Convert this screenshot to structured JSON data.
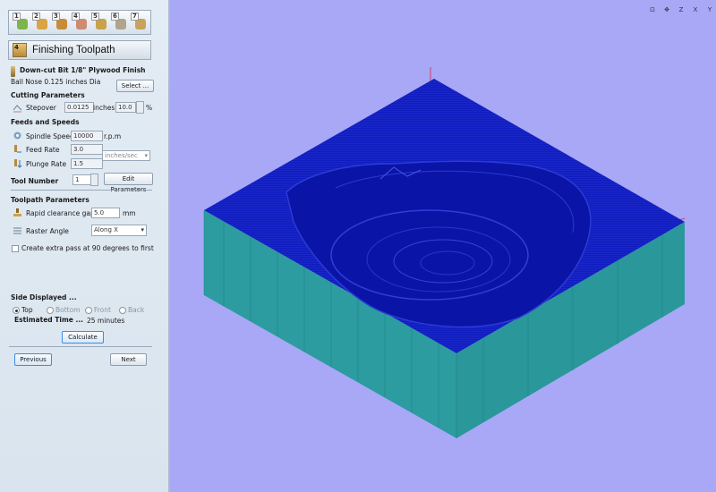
{
  "steps": [
    {
      "num": "1",
      "icon": "wizard-step-1-icon",
      "color": "#7ab648"
    },
    {
      "num": "2",
      "icon": "wizard-step-2-icon",
      "color": "#d9a441"
    },
    {
      "num": "3",
      "icon": "wizard-step-3-icon",
      "color": "#c98b35"
    },
    {
      "num": "4",
      "icon": "wizard-step-4-icon",
      "color": "#d08a70"
    },
    {
      "num": "5",
      "icon": "wizard-step-5-icon",
      "color": "#c9a24a"
    },
    {
      "num": "6",
      "icon": "wizard-step-6-icon",
      "color": "#b0a58a"
    },
    {
      "num": "7",
      "icon": "wizard-step-7-icon",
      "color": "#c7a45a"
    }
  ],
  "panel": {
    "step_badge": "4",
    "title": "Finishing Toolpath",
    "tool": {
      "name": "Down-cut Bit 1/8\"  Plywood Finish",
      "desc": "Ball Nose 0.125 inches Dia",
      "select_label": "Select ..."
    },
    "cutting": {
      "header": "Cutting Parameters",
      "stepover_label": "Stepover",
      "stepover_value": "0.0125",
      "stepover_unit": "inches",
      "percent_value": "10.0",
      "percent_sign": "%"
    },
    "feeds": {
      "header": "Feeds and Speeds",
      "spindle_label": "Spindle Speed",
      "spindle_value": "10000",
      "spindle_unit": "r.p.m",
      "feed_label": "Feed Rate",
      "feed_value": "3.0",
      "feed_unit": "inches/sec",
      "plunge_label": "Plunge Rate",
      "plunge_value": "1.5"
    },
    "tool_number": {
      "label": "Tool Number",
      "value": "1",
      "edit_label": "Edit Parameters"
    },
    "toolpath": {
      "header": "Toolpath Parameters",
      "rapid_label": "Rapid clearance gap",
      "rapid_value": "5.0",
      "rapid_unit": "mm",
      "raster_label": "Raster Angle",
      "raster_value": "Along X",
      "extra_pass_label": "Create extra pass at 90 degrees to first"
    },
    "side": {
      "header": "Side Displayed ...",
      "options": [
        "Top",
        "Bottom",
        "Front",
        "Back"
      ],
      "selected": "Top"
    },
    "estimate": {
      "label": "Estimated Time ...",
      "value": "25 minutes"
    },
    "calculate_label": "Calculate",
    "previous_label": "Previous",
    "next_label": "Next"
  },
  "view_toolbar": [
    "⊡",
    "✥",
    "Z",
    "X",
    "Y"
  ],
  "colors": {
    "viewport_bg": "#a8a8f7",
    "block_side": "#2f9ea2",
    "toolpath": "#0c17b7"
  }
}
